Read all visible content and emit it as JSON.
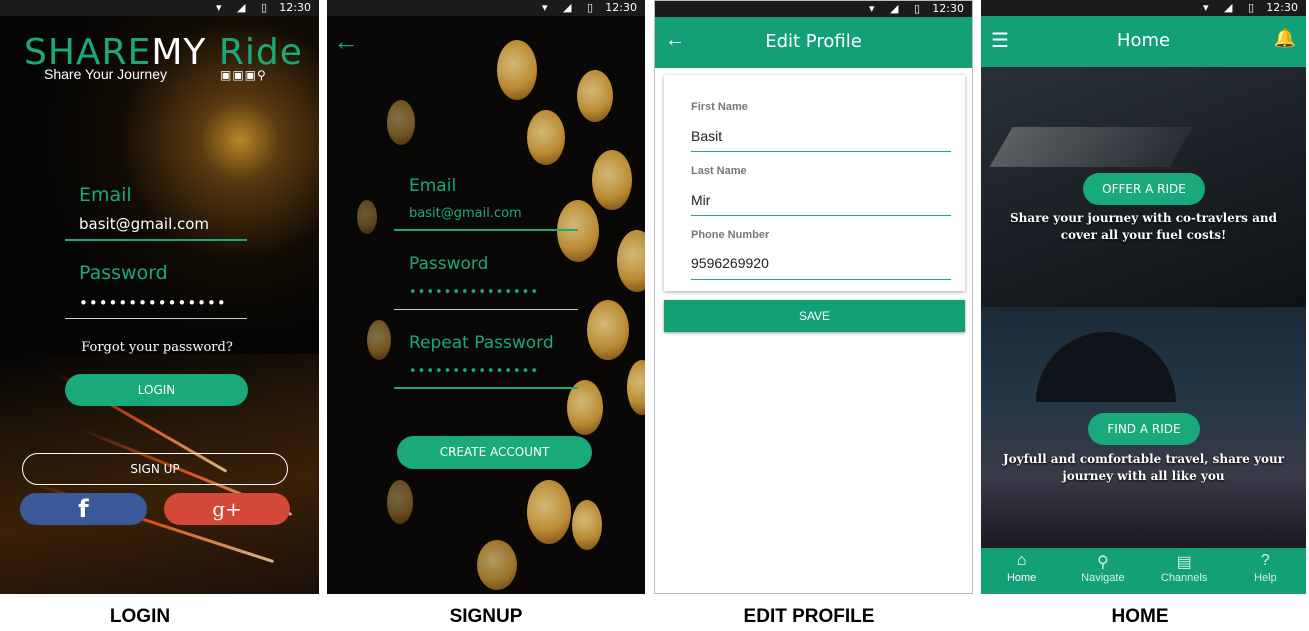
{
  "status": {
    "time": "12:30",
    "icons": "▾ ◢ ▯"
  },
  "login": {
    "logo_main_a": "SHARE",
    "logo_main_b": "MY",
    "logo_main_c": "Ride",
    "logo_sub": "Share Your Journey",
    "email_label": "Email",
    "email_value": "basit@gmail.com",
    "password_label": "Password",
    "password_value": "•••••••••••••••",
    "forgot": "Forgot your password?",
    "login_button": "LOGIN",
    "signup_button": "SIGN UP",
    "facebook_glyph": "f",
    "google_glyph": "g+",
    "caption": "LOGIN"
  },
  "signup": {
    "email_label": "Email",
    "email_value": "basit@gmail.com",
    "password_label": "Password",
    "password_value": "•••••••••••••••",
    "repeat_label": "Repeat Password",
    "repeat_value": "•••••••••••••••",
    "create_button": "CREATE ACCOUNT",
    "caption": "SIGNUP"
  },
  "edit": {
    "title": "Edit Profile",
    "first_label": "First Name",
    "first_value": "Basit",
    "last_label": "Last Name",
    "last_value": "Mir",
    "phone_label": "Phone Number",
    "phone_value": "9596269920",
    "save_button": "SAVE",
    "caption": "EDIT PROFILE"
  },
  "home": {
    "title": "Home",
    "offer_button": "OFFER A RIDE",
    "offer_desc": "Share your journey with co-travlers and cover all your fuel costs!",
    "find_button": "FIND A RIDE",
    "find_desc": "Joyfull and comfortable travel, share your journey with all like you",
    "nav": [
      {
        "label": "Home",
        "icon": "home-icon"
      },
      {
        "label": "Navigate",
        "icon": "location-pin-icon"
      },
      {
        "label": "Channels",
        "icon": "chat-icon"
      },
      {
        "label": "Help",
        "icon": "help-icon"
      }
    ],
    "caption": "HOME"
  },
  "colors": {
    "accent": "#14a075",
    "facebook": "#3b5998",
    "google": "#d34836"
  }
}
